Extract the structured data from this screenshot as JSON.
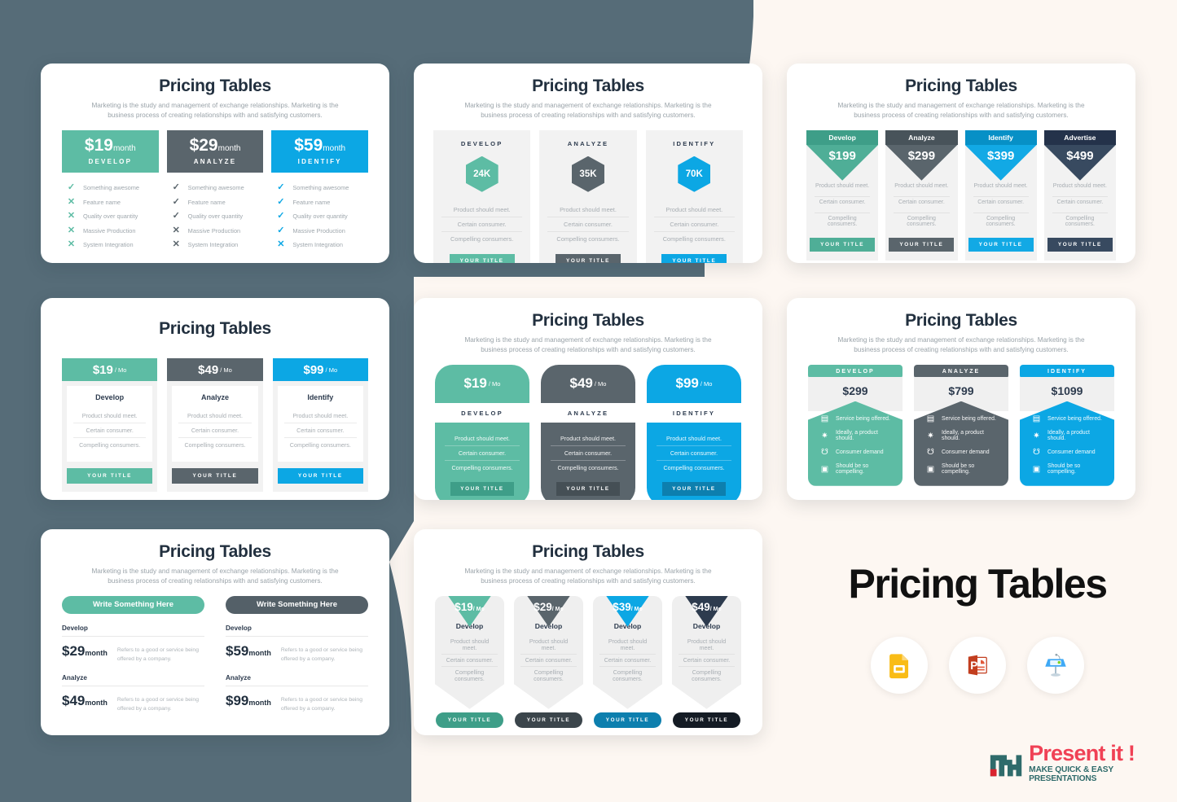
{
  "palette": {
    "background": "#FDF7F2",
    "dark_panel": "#566C78",
    "teal": "#5DBCA4",
    "gray": "#5A656C",
    "blue": "#0CA7E4",
    "navy": "#2D3B4E",
    "title_color": "#22303F",
    "muted_text": "#9FA7AD",
    "panel_bg": "#F2F2F2",
    "logo_red": "#F04155",
    "logo_teal": "#2F6B6B"
  },
  "common": {
    "title": "Pricing Tables",
    "subtitle": "Marketing is the study and management of exchange relationships. Marketing is the business process of creating relationships with and satisfying customers.",
    "button_label": "YOUR TITLE"
  },
  "card1": {
    "title": "Pricing Tables",
    "subtitle": "Marketing is the study and management of exchange relationships. Marketing is the business process of creating relationships with and satisfying customers.",
    "features": [
      "Something awesome",
      "Feature name",
      "Quality over quantity",
      "Massive Production",
      "System Integration"
    ],
    "columns": [
      {
        "price": "$19",
        "per": "month",
        "plan": "DEVELOP",
        "color": "#5DBCA4",
        "marks": [
          "check",
          "x",
          "x",
          "x",
          "x"
        ]
      },
      {
        "price": "$29",
        "per": "month",
        "plan": "ANALYZE",
        "color": "#5A656C",
        "marks": [
          "check",
          "check",
          "check",
          "x",
          "x"
        ]
      },
      {
        "price": "$59",
        "per": "month",
        "plan": "IDENTIFY",
        "color": "#0CA7E4",
        "marks": [
          "check",
          "check",
          "check",
          "check",
          "x"
        ]
      }
    ]
  },
  "card2": {
    "title": "Pricing Tables",
    "subtitle": "Marketing is the study and management of exchange relationships. Marketing is the business process of creating relationships with and satisfying customers.",
    "lines": [
      "Product should meet.",
      "Certain consumer.",
      "Compelling consumers."
    ],
    "columns": [
      {
        "plan": "DEVELOP",
        "value": "24K",
        "color": "#5DBCA4",
        "button": "YOUR TITLE"
      },
      {
        "plan": "ANALYZE",
        "value": "35K",
        "color": "#5A656C",
        "button": "YOUR TITLE"
      },
      {
        "plan": "IDENTIFY",
        "value": "70K",
        "color": "#0CA7E4",
        "button": "YOUR TITLE"
      }
    ]
  },
  "card3": {
    "title": "Pricing Tables",
    "subtitle": "Marketing is the study and management of exchange relationships. Marketing is the business process of creating relationships with and satisfying customers.",
    "lines": [
      "Product should meet.",
      "Certain consumer.",
      "Compelling consumers."
    ],
    "columns": [
      {
        "plan": "Develop",
        "price": "$199",
        "color": "#4FAE97",
        "band": "#3E9E88",
        "button": "YOUR TITLE"
      },
      {
        "plan": "Analyze",
        "price": "$299",
        "color": "#5A656C",
        "band": "#48535A",
        "button": "YOUR TITLE"
      },
      {
        "plan": "Identify",
        "price": "$399",
        "color": "#12A9E5",
        "band": "#0790C6",
        "button": "YOUR TITLE"
      },
      {
        "plan": "Advertise",
        "price": "$499",
        "color": "#384A60",
        "band": "#24324A",
        "button": "YOUR TITLE"
      }
    ]
  },
  "card4": {
    "title": "Pricing Tables",
    "lines": [
      "Product should meet.",
      "Certain consumer.",
      "Compelling consumers."
    ],
    "columns": [
      {
        "price": "$19",
        "per": "/ Mo",
        "plan": "Develop",
        "color": "#5DBCA4",
        "button": "YOUR TITLE"
      },
      {
        "price": "$49",
        "per": "/ Mo",
        "plan": "Analyze",
        "color": "#5A656C",
        "button": "YOUR TITLE"
      },
      {
        "price": "$99",
        "per": "/ Mo",
        "plan": "Identify",
        "color": "#0CA7E4",
        "button": "YOUR TITLE"
      }
    ]
  },
  "card5": {
    "title": "Pricing Tables",
    "subtitle": "Marketing is the study and management of exchange relationships. Marketing is the business process of creating relationships with and satisfying customers.",
    "lines": [
      "Product should meet.",
      "Certain consumer.",
      "Compelling consumers."
    ],
    "columns": [
      {
        "price": "$19",
        "per": "/ Mo",
        "plan": "DEVELOP",
        "color": "#5DBCA4",
        "button": "YOUR TITLE",
        "button_color": "#3E9E88"
      },
      {
        "price": "$49",
        "per": "/ Mo",
        "plan": "ANALYZE",
        "color": "#5A656C",
        "button": "YOUR TITLE",
        "button_color": "#454F55"
      },
      {
        "price": "$99",
        "per": "/ Mo",
        "plan": "IDENTIFY",
        "color": "#0CA7E4",
        "button": "YOUR TITLE",
        "button_color": "#0D7FAE"
      }
    ]
  },
  "card6": {
    "title": "Pricing Tables",
    "subtitle": "Marketing is the study and management of exchange relationships. Marketing is the business process of creating relationships with and satisfying customers.",
    "items": [
      "Service being offered.",
      "Ideally, a product should.",
      "Consumer demand",
      "Should be so compelling."
    ],
    "icons": [
      "server-icon",
      "gear-icon",
      "hand-growth-icon",
      "presentation-chart-icon"
    ],
    "columns": [
      {
        "plan": "DEVELOP",
        "price": "$299",
        "color": "#5DBCA4"
      },
      {
        "plan": "ANALYZE",
        "price": "$799",
        "color": "#5A656C"
      },
      {
        "plan": "IDENTIFY",
        "price": "$1099",
        "color": "#0CA7E4"
      }
    ]
  },
  "card7": {
    "title": "Pricing Tables",
    "subtitle": "Marketing is the study and management of exchange relationships. Marketing is the business process of creating relationships with and satisfying customers.",
    "description": "Refers to a good or service being offered by a company.",
    "columns": [
      {
        "header": "Write Something Here",
        "color": "#5DBCA4",
        "rows": [
          {
            "name": "Develop",
            "amount": "$29",
            "per": "month",
            "desc": "Refers to a good or service being offered by a company."
          },
          {
            "name": "Analyze",
            "amount": "$49",
            "per": "month",
            "desc": "Refers to a good or service being offered by a company."
          }
        ]
      },
      {
        "header": "Write Something Here",
        "color": "#546068",
        "rows": [
          {
            "name": "Develop",
            "amount": "$59",
            "per": "month",
            "desc": "Refers to a good or service being offered by a company."
          },
          {
            "name": "Analyze",
            "amount": "$99",
            "per": "month",
            "desc": "Refers to a good or service being offered by a company."
          }
        ]
      }
    ]
  },
  "card8": {
    "title": "Pricing Tables",
    "subtitle": "Marketing is the study and management of exchange relationships. Marketing is the business process of creating relationships with and satisfying customers.",
    "lines": [
      "Product should meet.",
      "Certain consumer.",
      "Compelling consumers."
    ],
    "columns": [
      {
        "price": "$19",
        "per": "/ Mo",
        "plan": "Develop",
        "color": "#5DBCA4",
        "button": "YOUR TITLE",
        "button_color": "#3E9E88"
      },
      {
        "price": "$29",
        "per": "/ Mo",
        "plan": "Develop",
        "color": "#5A656C",
        "button": "YOUR TITLE",
        "button_color": "#3B454B"
      },
      {
        "price": "$39",
        "per": "/ Mo",
        "plan": "Develop",
        "color": "#0CA7E4",
        "button": "YOUR TITLE",
        "button_color": "#0D7FAE"
      },
      {
        "price": "$49",
        "per": "/ Mo",
        "plan": "Develop",
        "color": "#2D3B4E",
        "button": "YOUR TITLE",
        "button_color": "#141B24"
      }
    ]
  },
  "branding": {
    "headline": "Pricing Tables",
    "platform_icons": [
      "google-slides-icon",
      "powerpoint-icon",
      "keynote-icon"
    ],
    "logo": {
      "name": "Present it !",
      "tagline": "MAKE QUICK & EASY PRESENTATIONS"
    }
  }
}
